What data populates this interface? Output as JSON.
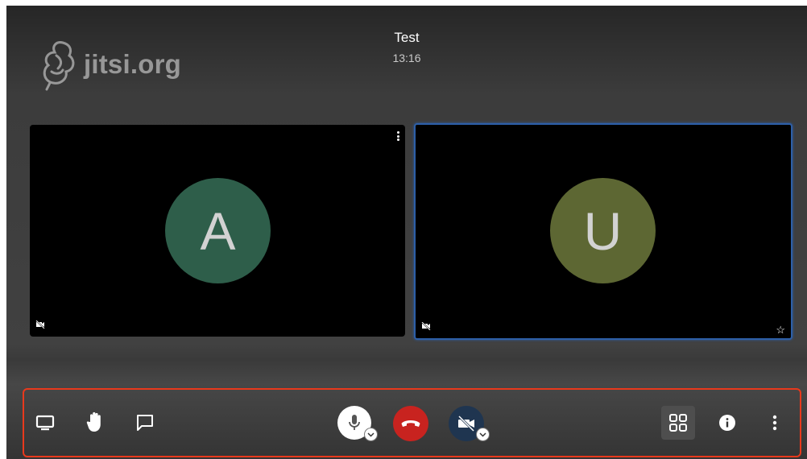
{
  "meeting": {
    "subject": "Test",
    "timer": "13:16"
  },
  "logo": {
    "text": "jitsi.org"
  },
  "participants": [
    {
      "initial": "A",
      "color": "#2e5e4a",
      "video": "off"
    },
    {
      "initial": "U",
      "color": "#5d6733",
      "video": "off",
      "dominant": true
    }
  ],
  "toolbar": {
    "left": [
      "screen-share-icon",
      "raise-hand-icon",
      "chat-icon"
    ],
    "center": [
      "microphone-icon",
      "hangup-icon",
      "camera-off-icon"
    ],
    "right": [
      "tile-view-icon",
      "info-icon",
      "more-icon"
    ]
  },
  "colors": {
    "hangup": "#c8231f",
    "highlight_border": "#e8391c",
    "active_speaker": "#2d5fa8"
  }
}
